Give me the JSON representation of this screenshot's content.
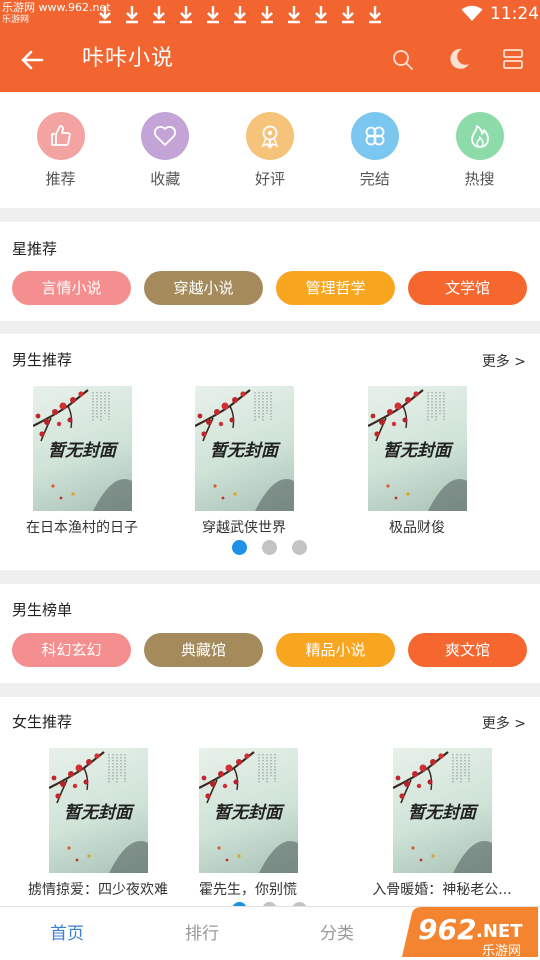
{
  "status_bar": {
    "site": "乐游网 www.962.net",
    "site_short": "乐游网",
    "time": "11:24"
  },
  "app_bar": {
    "title": "咔咔小说"
  },
  "quick_nav": [
    {
      "label": "推荐",
      "icon": "thumbs-up-icon",
      "color": "#f4a3a3"
    },
    {
      "label": "收藏",
      "icon": "heart-icon",
      "color": "#c4a4d6"
    },
    {
      "label": "好评",
      "icon": "award-badge-icon",
      "color": "#f6c37a"
    },
    {
      "label": "完结",
      "icon": "clover-icon",
      "color": "#7cc7f0"
    },
    {
      "label": "热搜",
      "icon": "flame-icon",
      "color": "#8ddba8"
    }
  ],
  "star_recommend": {
    "title": "星推荐",
    "tags": [
      {
        "label": "言情小说",
        "color": "#f58e8e"
      },
      {
        "label": "穿越小说",
        "color": "#a58b5c"
      },
      {
        "label": "管理哲学",
        "color": "#f8a620"
      },
      {
        "label": "文学馆",
        "color": "#f6672f"
      }
    ]
  },
  "male_recommend": {
    "title": "男生推荐",
    "more": "更多 >",
    "books": [
      {
        "title": "在日本渔村的日子",
        "cover_text": "暂无封面"
      },
      {
        "title": "穿越武侠世界",
        "cover_text": "暂无封面"
      },
      {
        "title": "极品财俊",
        "cover_text": "暂无封面"
      }
    ],
    "page_count": 3,
    "active_page": 1
  },
  "male_rank": {
    "title": "男生榜单",
    "tags": [
      {
        "label": "科幻玄幻",
        "color": "#f58e8e"
      },
      {
        "label": "典藏馆",
        "color": "#a58b5c"
      },
      {
        "label": "精品小说",
        "color": "#f8a620"
      },
      {
        "label": "爽文馆",
        "color": "#f6672f"
      }
    ]
  },
  "female_recommend": {
    "title": "女生推荐",
    "more": "更多 >",
    "books": [
      {
        "title": "掳情掠爱：四少夜欢难",
        "cover_text": "暂无封面"
      },
      {
        "title": "霍先生，你别慌",
        "cover_text": "暂无封面"
      },
      {
        "title": "入骨暖婚：神秘老公...",
        "cover_text": "暂无封面"
      }
    ]
  },
  "bottom_nav": [
    {
      "label": "首页",
      "active": true
    },
    {
      "label": "排行",
      "active": false
    },
    {
      "label": "分类",
      "active": false
    }
  ],
  "watermark": {
    "text": "962",
    "suffix": ".NET",
    "sub": "乐游网"
  }
}
